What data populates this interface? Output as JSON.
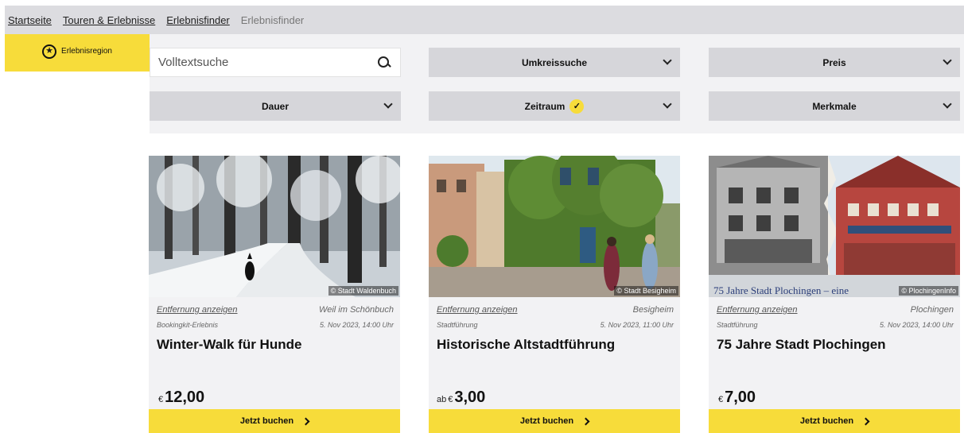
{
  "breadcrumb": [
    "Startseite",
    "Touren & Erlebnisse",
    "Erlebnisfinder",
    "Erlebnisfinder"
  ],
  "region_tab": {
    "label": "Erlebnisregion",
    "icon": "star-circle-icon"
  },
  "search": {
    "placeholder": "Volltextsuche",
    "value": ""
  },
  "filters": {
    "umkreissuche": "Umkreissuche",
    "preis": "Preis",
    "dauer": "Dauer",
    "zeitraum": "Zeitraum",
    "merkmale": "Merkmale"
  },
  "cards": [
    {
      "credit": "© Stadt Waldenbuch",
      "distance_link": "Entfernung anzeigen",
      "place": "Weil im Schönbuch",
      "type": "Bookingkit-Erlebnis",
      "date": "5. Nov 2023, 14:00 Uhr",
      "title": "Winter-Walk für Hunde",
      "price_prefix": "",
      "currency": "€",
      "price": "12,00",
      "book_label": "Jetzt buchen"
    },
    {
      "credit": "© Stadt Besigheim",
      "distance_link": "Entfernung anzeigen",
      "place": "Besigheim",
      "type": "Stadtführung",
      "date": "5. Nov 2023, 11:00 Uhr",
      "title": "Historische Altstadtführung",
      "price_prefix": "ab",
      "currency": "€",
      "price": "3,00",
      "book_label": "Jetzt buchen"
    },
    {
      "credit": "© PlochingenInfo",
      "distance_link": "Entfernung anzeigen",
      "place": "Plochingen",
      "type": "Stadtführung",
      "date": "5. Nov 2023, 14:00 Uhr",
      "title": "75 Jahre Stadt Plochingen",
      "image_caption": "75 Jahre Stadt Plochingen – eine",
      "price_prefix": "",
      "currency": "€",
      "price": "7,00",
      "book_label": "Jetzt buchen"
    }
  ],
  "colors": {
    "accent": "#f7dc3a",
    "bar": "#dcdce0",
    "filter_bg": "#f2f2f4",
    "dropdown": "#d6d6da"
  }
}
